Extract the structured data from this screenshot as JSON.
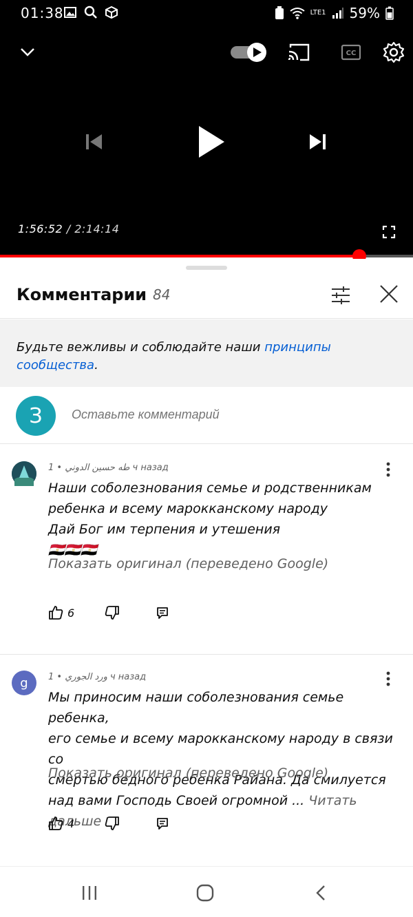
{
  "status_bar": {
    "time": "01:38",
    "battery": "59%",
    "network": "LTE1"
  },
  "player": {
    "current_time": "1:56:52",
    "separator": " / ",
    "duration": "2:14:14",
    "progress": 0.87,
    "autoplay": true
  },
  "comments_panel": {
    "title": "Комментарии",
    "count": "84",
    "guidelines_text": "Будьте вежливы и соблюдайте наши ",
    "guidelines_link": "принципы сообщества",
    "guidelines_end": ".",
    "my_avatar_letter": "З",
    "add_comment_placeholder": "Оставьте комментарий"
  },
  "comments": [
    {
      "author": "طه حسين الدوني",
      "time": "1 ч назад",
      "lines": [
        "Наши соболезнования семье и родственникам",
        "ребенка и всему марокканскому народу",
        "Дай Бог им терпения и утешения",
        "🇪🇬🇪🇬🇪🇬"
      ],
      "translate_label": "Показать оригинал (переведено Google)",
      "likes": "6",
      "avatar_color": "#2a5f6a"
    },
    {
      "author": "ورد الجوري",
      "time": "1 ч назад",
      "avatar_letter": "g",
      "lines": [
        "Мы приносим наши соболезнования семье ребенка,",
        "его семье и всему марокканскому народу в связи со",
        "смертью бедного ребенка Райана. Да смилуется",
        "над вами Господь Своей огромной ..."
      ],
      "read_more": "Читать дальше",
      "translate_label": "Показать оригинал (переведено Google)",
      "likes": "4",
      "avatar_color": "#5c6bc0"
    }
  ],
  "icons": {
    "collapse": "chevron-down-icon",
    "cast": "cast-icon",
    "captions": "cc-icon",
    "settings": "gear-icon",
    "prev": "skip-previous-icon",
    "play": "play-icon",
    "next": "skip-next-icon",
    "fullscreen": "fullscreen-icon",
    "filter": "sort-filter-icon",
    "close": "close-icon",
    "like": "thumb-up-icon",
    "dislike": "thumb-down-icon",
    "reply": "reply-icon",
    "more": "more-vert-icon"
  },
  "colors": {
    "progress": "#ff0000",
    "link": "#065fd4",
    "my_avatar": "#1aa3b3"
  }
}
